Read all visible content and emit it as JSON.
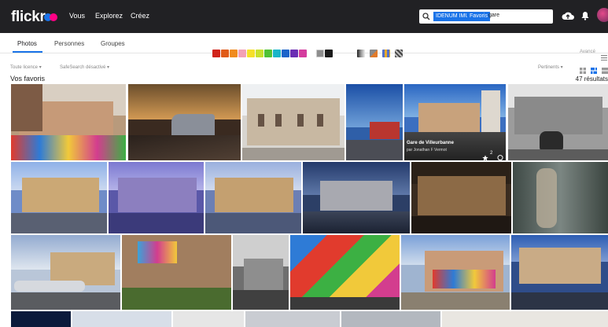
{
  "topbar": {
    "logo": "flickr",
    "nav": [
      "Vous",
      "Explorez",
      "Créez"
    ],
    "search_chips": [
      "IDENUM IMU",
      "Favoris"
    ],
    "search_query": "gare"
  },
  "subnav": {
    "tabs": [
      "Photos",
      "Personnes",
      "Groupes"
    ],
    "advanced": "Avancé"
  },
  "colors": {
    "swatches": [
      "#d0231a",
      "#e05a17",
      "#f08a1d",
      "#f3a1b5",
      "#f6e02a",
      "#c8e12d",
      "#4fc234",
      "#17b5c8",
      "#1b63c9",
      "#6b2db3",
      "#d43c9e",
      "#ffffff",
      "#8e8e8e",
      "#1a1a1a"
    ],
    "brand": "#1a73e8",
    "topbar": "#212124"
  },
  "filters": {
    "license": "Toute licence",
    "safesearch": "SafeSearch désactivé",
    "sort": "Pertinents"
  },
  "section": {
    "title": "Vos favoris",
    "count": "47 résultats"
  },
  "photo": {
    "title": "Gare de Villeurbanne",
    "author": "par Jonathan F Vermot",
    "faves": "2"
  },
  "icons": [
    "search-icon",
    "cloud-upload-icon",
    "bell-icon",
    "menu-icon",
    "grid-view-icon",
    "justified-view-icon",
    "list-view-icon",
    "star-icon",
    "comment-icon"
  ]
}
